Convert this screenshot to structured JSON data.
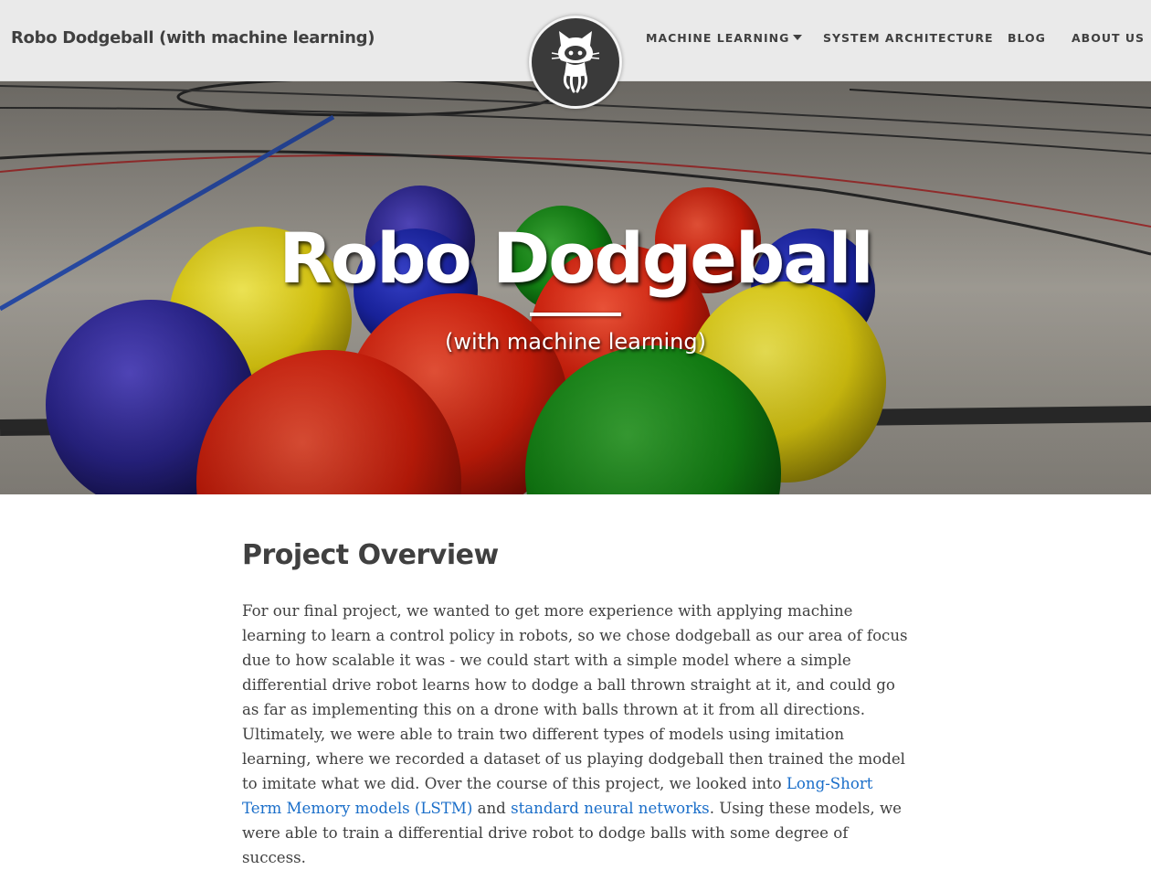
{
  "navbar": {
    "brand": "Robo Dodgeball (with machine learning)",
    "links": {
      "machine_learning": "MACHINE LEARNING",
      "system_architecture": "SYSTEM ARCHITECTURE",
      "blog": "BLOG",
      "about_us": "ABOUT US"
    },
    "avatar_icon": "github-octocat-icon"
  },
  "hero": {
    "title": "Robo Dodgeball",
    "subtitle": "(with machine learning)"
  },
  "main": {
    "section_title": "Project Overview",
    "paragraph": {
      "text_1": "For our final project, we wanted to get more experience with applying machine learning to learn a control policy in robots, so we chose dodgeball as our area of focus due to how scalable it was - we could start with a simple model where a simple differential drive robot learns how to dodge a ball thrown straight at it, and could go as far as implementing this on a drone with balls thrown at it from all directions. Ultimately, we were able to train two different types of models using imitation learning, where we recorded a dataset of us playing dodgeball then trained the model to imitate what we did. Over the course of this project, we looked into ",
      "link_lstm": "Long-Short Term Memory models (LSTM)",
      "text_2": " and ",
      "link_nn": "standard neural networks",
      "text_3": ". Using these models, we were able to train a differential drive robot to dodge balls with some degree of success."
    }
  },
  "colors": {
    "navbar_bg": "#eaeaea",
    "text": "#404040",
    "link": "#1a6ec9"
  }
}
